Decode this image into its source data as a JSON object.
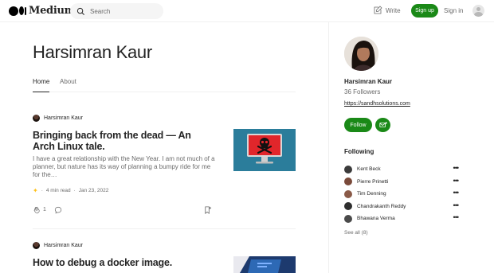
{
  "header": {
    "brand": "Medium",
    "search_placeholder": "Search",
    "write_label": "Write",
    "signup_label": "Sign up",
    "signin_label": "Sign in"
  },
  "profile": {
    "name": "Harsimran Kaur",
    "tabs": [
      {
        "label": "Home",
        "active": true
      },
      {
        "label": "About",
        "active": false
      }
    ]
  },
  "articles": [
    {
      "author": "Harsimran Kaur",
      "title": "Bringing back from the dead — An Arch Linux tale.",
      "subtitle": "I have a great relationship with the New Year. I am not much of a planner, but nature has its way of planning a bumpy ride for me for the…",
      "read_time": "4 min read",
      "date": "Jan 23, 2022",
      "claps": "1"
    },
    {
      "author": "Harsimran Kaur",
      "title": "How to debug a docker image."
    }
  ],
  "sidebar": {
    "name": "Harsimran Kaur",
    "followers": "36 Followers",
    "link": "https://sandhsolutions.com",
    "follow_label": "Follow",
    "following_heading": "Following",
    "following": [
      {
        "name": "Kent Beck"
      },
      {
        "name": "Pierre Prinetti"
      },
      {
        "name": "Tim Denning"
      },
      {
        "name": "Chandrakanth Reddy"
      },
      {
        "name": "Bhawana Verma"
      }
    ],
    "see_all": "See all (8)"
  },
  "colors": {
    "accent_green": "#1a8917",
    "text_primary": "#242424",
    "text_secondary": "#6b6b6b",
    "member_star": "#ffc017"
  }
}
